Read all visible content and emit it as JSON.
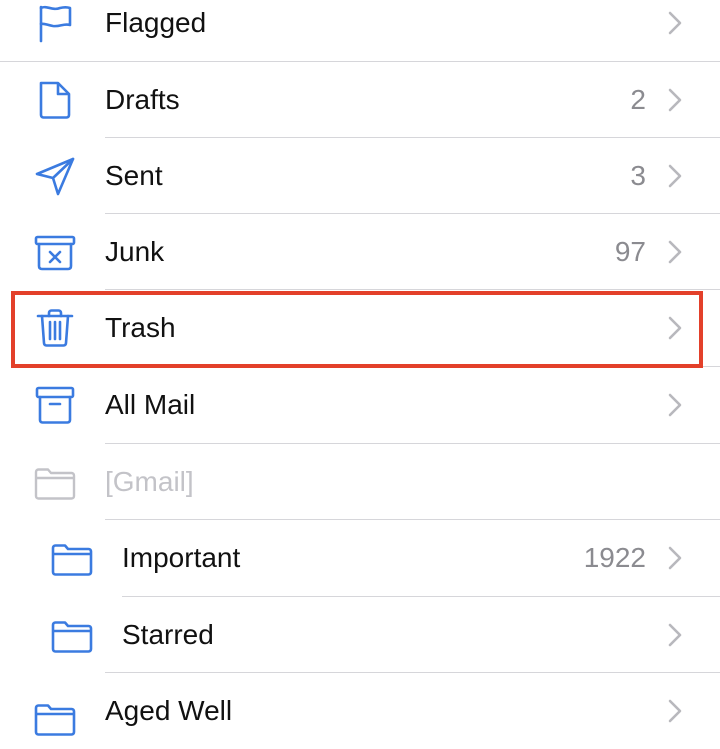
{
  "colors": {
    "accent": "#3b7be0",
    "disabled": "#c3c3c8",
    "highlight": "#e3402a"
  },
  "rows": [
    {
      "label": "Flagged",
      "count": "",
      "icon": "flag-icon"
    },
    {
      "label": "Drafts",
      "count": "2",
      "icon": "document-icon"
    },
    {
      "label": "Sent",
      "count": "3",
      "icon": "paper-plane-icon"
    },
    {
      "label": "Junk",
      "count": "97",
      "icon": "junk-bin-icon"
    },
    {
      "label": "Trash",
      "count": "",
      "icon": "trash-icon"
    },
    {
      "label": "All Mail",
      "count": "",
      "icon": "archive-box-icon"
    },
    {
      "label": "[Gmail]",
      "count": "",
      "icon": "folder-icon"
    },
    {
      "label": "Important",
      "count": "1922",
      "icon": "folder-icon"
    },
    {
      "label": "Starred",
      "count": "",
      "icon": "folder-icon"
    },
    {
      "label": "Aged Well",
      "count": "",
      "icon": "folder-icon"
    }
  ]
}
